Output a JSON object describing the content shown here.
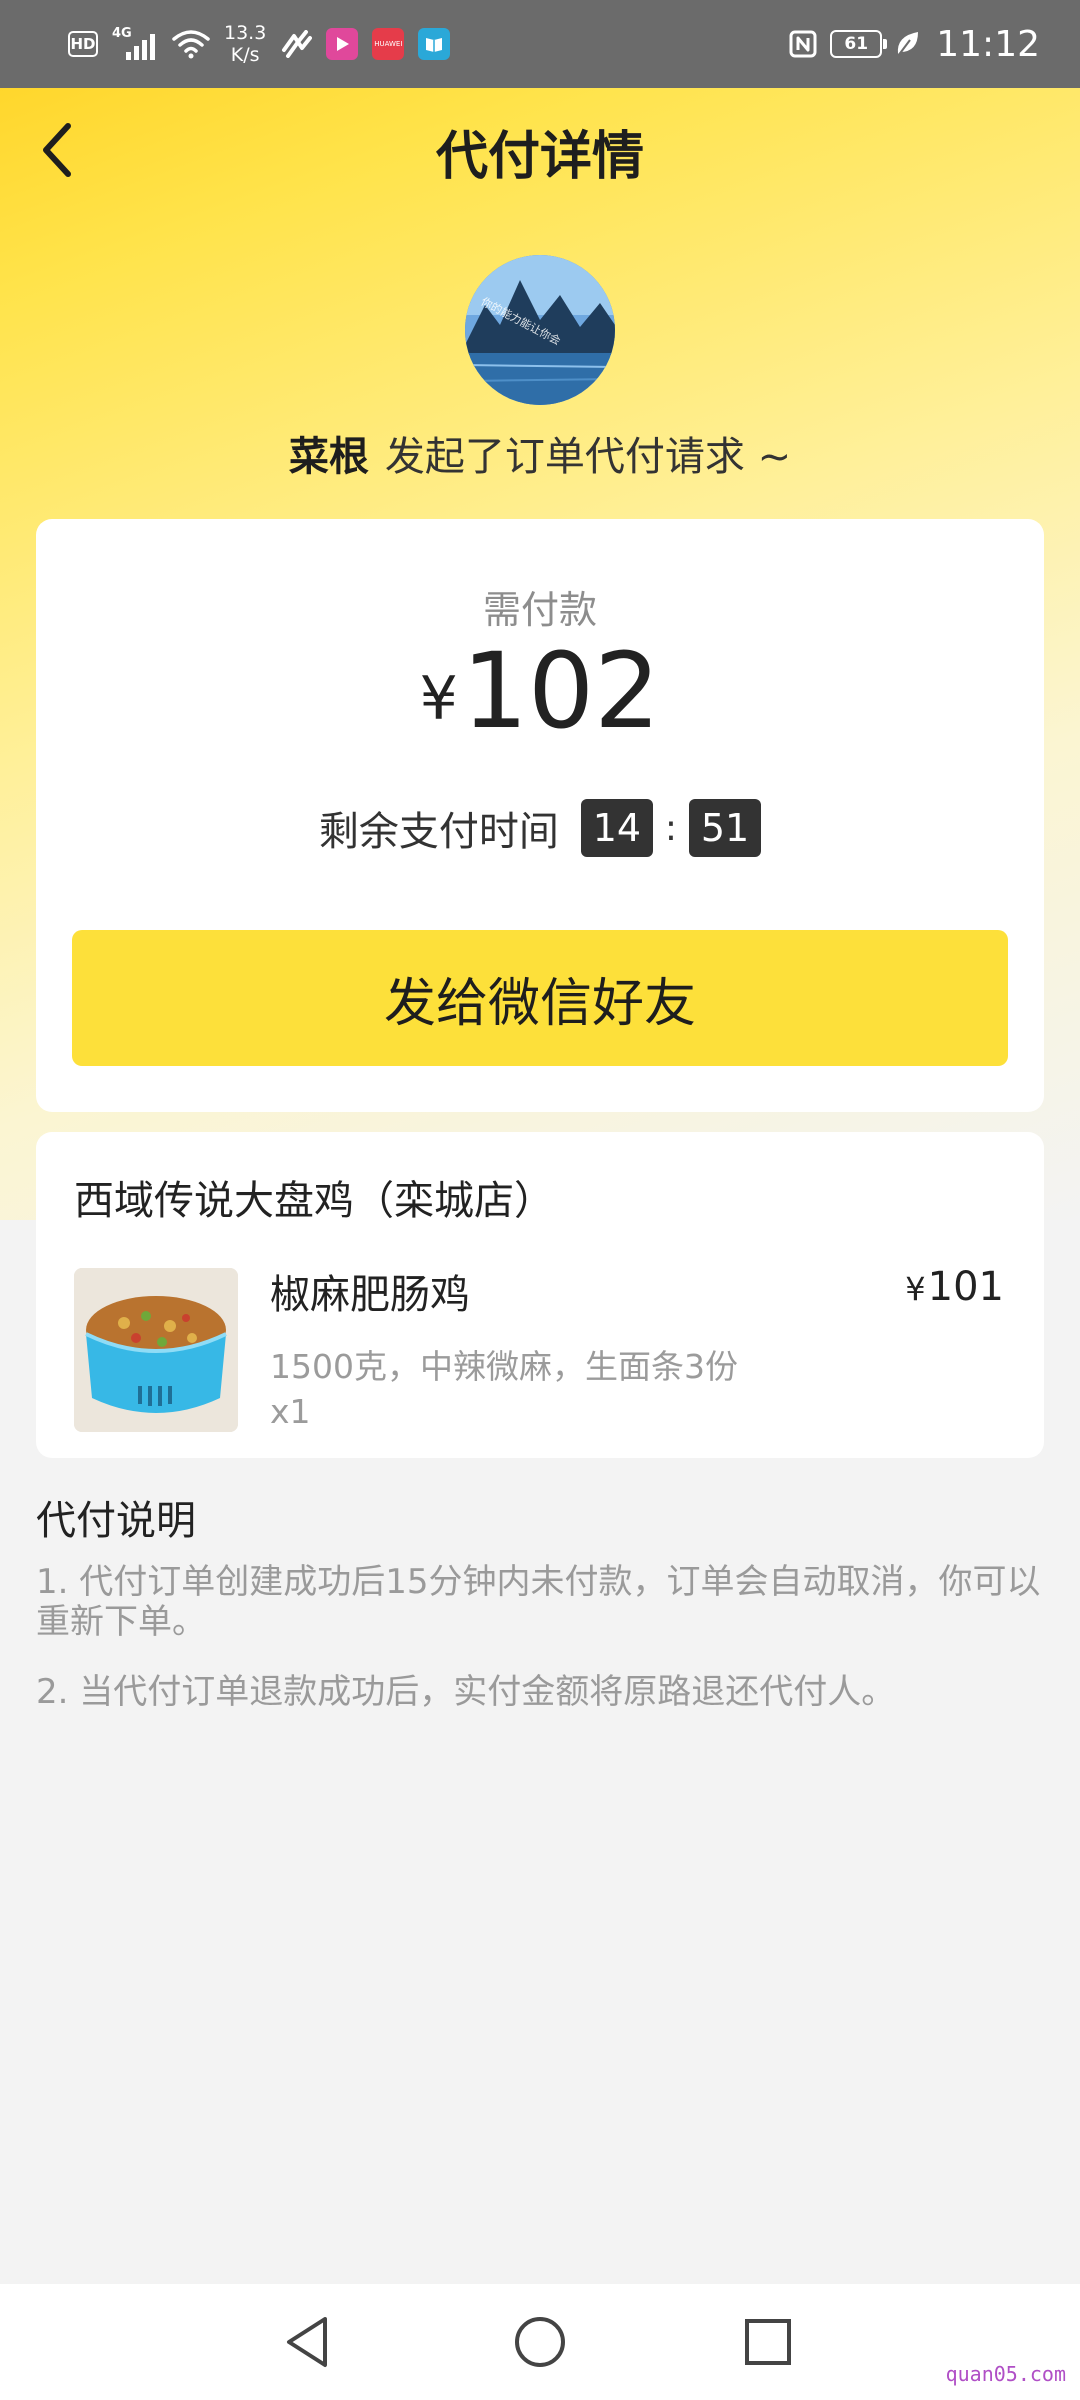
{
  "status_bar": {
    "hd": "HD",
    "network": "4G",
    "speed_value": "13.3",
    "speed_unit": "K/s",
    "battery": "61",
    "time": "11:12",
    "app_icon_labels": [
      "HUAWEI"
    ]
  },
  "header": {
    "title": "代付详情"
  },
  "requester": {
    "name": "菜根",
    "message": "发起了订单代付请求 ~",
    "avatar_caption": "你的能力能让你会"
  },
  "payment": {
    "label": "需付款",
    "currency": "¥",
    "amount": "102",
    "countdown_label": "剩余支付时间",
    "minutes": "14",
    "separator": ":",
    "seconds": "51",
    "button_label": "发给微信好友"
  },
  "order": {
    "shop_name": "西域传说大盘鸡（栾城店）",
    "item": {
      "name": "椒麻肥肠鸡",
      "currency": "¥",
      "price": "101",
      "spec": "1500克，中辣微麻，生面条3份",
      "quantity": "x1"
    }
  },
  "notes": {
    "title": "代付说明",
    "items": [
      "1. 代付订单创建成功后15分钟内未付款，订单会自动取消，你可以重新下单。",
      "2. 当代付订单退款成功后，实付金额将原路退还代付人。"
    ]
  },
  "watermark": "quan05.com",
  "colors": {
    "accent_yellow": "#fde03a",
    "status_bar": "#6b6b6b",
    "timer_box": "#333333"
  }
}
